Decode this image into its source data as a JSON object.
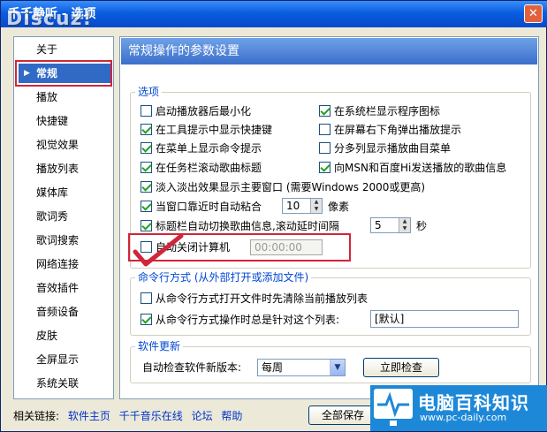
{
  "window": {
    "title": "千千静听 - 选项",
    "watermark": "Discuz!",
    "close_label": "✕"
  },
  "sidebar": {
    "items": [
      {
        "label": "关于",
        "selected": false
      },
      {
        "label": "常规",
        "selected": true
      },
      {
        "label": "播放",
        "selected": false
      },
      {
        "label": "快捷键",
        "selected": false
      },
      {
        "label": "视觉效果",
        "selected": false
      },
      {
        "label": "播放列表",
        "selected": false
      },
      {
        "label": "媒体库",
        "selected": false
      },
      {
        "label": "歌词秀",
        "selected": false
      },
      {
        "label": "歌词搜索",
        "selected": false
      },
      {
        "label": "网络连接",
        "selected": false
      },
      {
        "label": "音效插件",
        "selected": false
      },
      {
        "label": "音频设备",
        "selected": false
      },
      {
        "label": "皮肤",
        "selected": false
      },
      {
        "label": "全屏显示",
        "selected": false
      },
      {
        "label": "系统关联",
        "selected": false
      }
    ]
  },
  "main": {
    "header": "常规操作的参数设置",
    "options": {
      "group_label": "选项",
      "checks": [
        {
          "label": "启动播放器后最小化",
          "checked": false
        },
        {
          "label": "在系统栏显示程序图标",
          "checked": true
        },
        {
          "label": "在工具提示中显示快捷键",
          "checked": true
        },
        {
          "label": "在屏幕右下角弹出播放提示",
          "checked": false
        },
        {
          "label": "在菜单上显示命令提示",
          "checked": true
        },
        {
          "label": "分多列显示播放曲目菜单",
          "checked": false
        },
        {
          "label": "在任务栏滚动歌曲标题",
          "checked": true
        },
        {
          "label": "向MSN和百度Hi发送播放的歌曲信息",
          "checked": true
        },
        {
          "label": "淡入淡出效果显示主要窗口 (需要Windows 2000或更高)",
          "checked": true
        }
      ],
      "snap": {
        "label": "当窗口靠近时自动粘合",
        "value": "10",
        "unit": "像素",
        "checked": true
      },
      "scroll": {
        "label": "标题栏自动切换歌曲信息,滚动延时间隔",
        "value": "5",
        "unit": "秒",
        "checked": true
      },
      "shutdown": {
        "label": "自动关闭计算机",
        "time": "00:00:00",
        "checked": false
      }
    },
    "cmdline": {
      "group_label": "命令行方式 (从外部打开或添加文件)",
      "clear": {
        "label": "从命令行方式打开文件时先清除当前播放列表",
        "checked": false
      },
      "target": {
        "label": "从命令行方式操作时总是针对这个列表:",
        "value": "[默认]",
        "checked": true
      }
    },
    "update": {
      "group_label": "软件更新",
      "label": "自动检查软件新版本:",
      "selected": "每周",
      "check_now": "立即检查"
    }
  },
  "footer": {
    "label": "相关链接:",
    "links": [
      "软件主页",
      "千千音乐在线",
      "论坛",
      "帮助"
    ],
    "save_all": "全部保存"
  },
  "logo": {
    "cn": "电脑百科知识",
    "url": "www.pc-daily.com"
  },
  "colors": {
    "title_blue": "#0a5ddf",
    "selection": "#316ac5",
    "group_title": "#0046d5",
    "highlight_red": "#d0263a",
    "check_green": "#21a121"
  }
}
